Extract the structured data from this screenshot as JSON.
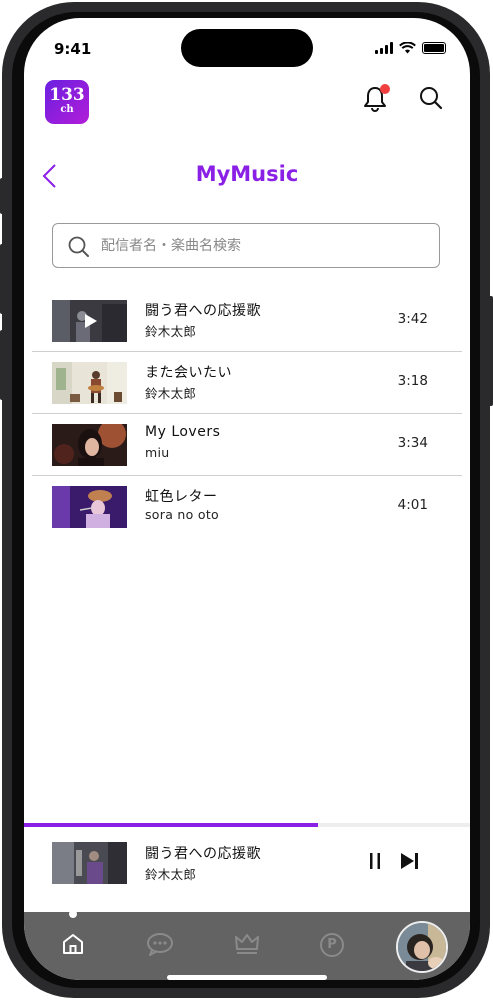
{
  "status": {
    "time": "9:41"
  },
  "logo": {
    "number": "133",
    "sub": "ch"
  },
  "header": {
    "title": "MyMusic"
  },
  "search": {
    "placeholder": "配信者名・楽曲名検索"
  },
  "tracks": [
    {
      "title": "闘う君への応援歌",
      "artist": "鈴木太郎",
      "duration": "3:42"
    },
    {
      "title": "また会いたい",
      "artist": "鈴木太郎",
      "duration": "3:18"
    },
    {
      "title": "My Lovers",
      "artist": "miu",
      "duration": "3:34"
    },
    {
      "title": "虹色レター",
      "artist": "sora no oto",
      "duration": "4:01"
    }
  ],
  "now_playing": {
    "title": "闘う君への応援歌",
    "artist": "鈴木太郎",
    "progress": 0.66
  },
  "tabs": [
    {
      "icon": "home-icon"
    },
    {
      "icon": "chat-icon"
    },
    {
      "icon": "crown-icon"
    },
    {
      "icon": "points-icon",
      "label": "P"
    }
  ],
  "colors": {
    "accent": "#8a1fe6",
    "notification": "#f04040",
    "tabbar": "#636363"
  }
}
